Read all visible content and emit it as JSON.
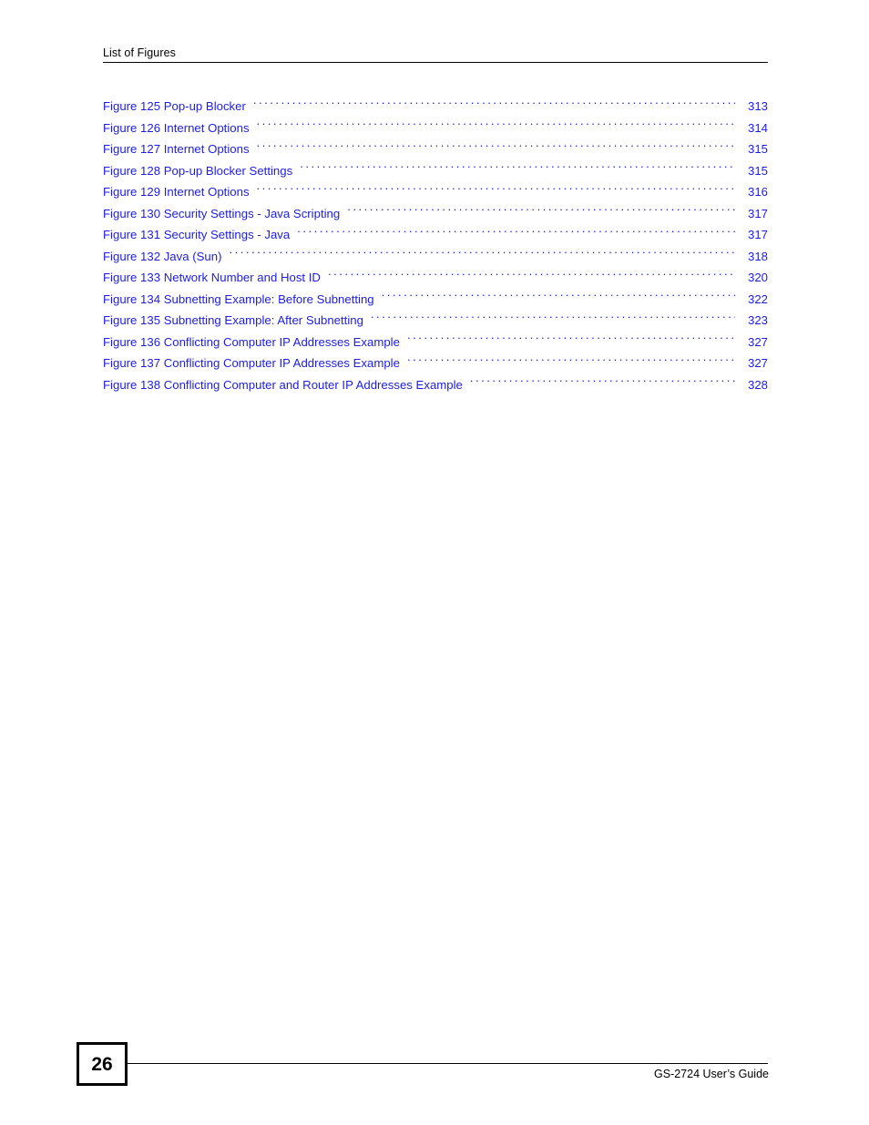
{
  "header": {
    "title": "List of Figures"
  },
  "colors": {
    "link_blue": "#1d1de4",
    "text_black": "#000000",
    "page_background": "#ffffff"
  },
  "toc": {
    "entries": [
      {
        "label": "Figure 125 Pop-up Blocker",
        "page": "313"
      },
      {
        "label": "Figure 126 Internet Options",
        "page": "314"
      },
      {
        "label": "Figure 127 Internet Options",
        "page": "315"
      },
      {
        "label": "Figure 128 Pop-up Blocker Settings",
        "page": "315"
      },
      {
        "label": "Figure 129 Internet Options",
        "page": "316"
      },
      {
        "label": "Figure 130 Security Settings - Java Scripting",
        "page": "317"
      },
      {
        "label": "Figure 131 Security Settings - Java",
        "page": "317"
      },
      {
        "label": "Figure 132 Java (Sun)",
        "page": "318"
      },
      {
        "label": "Figure 133 Network Number and Host ID",
        "page": "320"
      },
      {
        "label": "Figure 134 Subnetting Example: Before Subnetting",
        "page": "322"
      },
      {
        "label": "Figure 135 Subnetting Example: After Subnetting",
        "page": "323"
      },
      {
        "label": "Figure 136 Conflicting Computer IP Addresses Example",
        "page": "327"
      },
      {
        "label": "Figure 137 Conflicting Computer IP Addresses Example",
        "page": "327"
      },
      {
        "label": "Figure 138 Conflicting Computer and Router IP Addresses Example",
        "page": "328"
      }
    ]
  },
  "footer": {
    "page_number": "26",
    "guide_title": "GS-2724 User’s Guide"
  }
}
